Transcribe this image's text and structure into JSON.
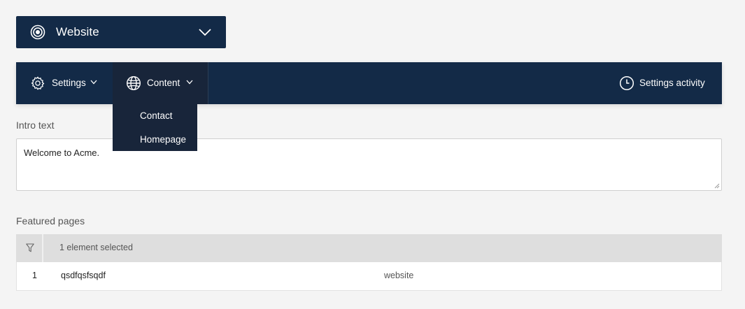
{
  "site_switcher": {
    "label": "Website",
    "icon": "target-icon"
  },
  "navbar": {
    "settings_label": "Settings",
    "content_label": "Content",
    "activity_label": "Settings activity"
  },
  "content_menu": {
    "items": [
      "Contact",
      "Homepage"
    ]
  },
  "intro": {
    "label": "Intro text",
    "value": "Welcome to Acme."
  },
  "featured": {
    "label": "Featured pages",
    "selected_text": "1 element selected",
    "rows": [
      {
        "index": "1",
        "title": "qsdfqsfsqdf",
        "site": "website"
      }
    ]
  },
  "colors": {
    "nav_bg": "#132a47",
    "dropdown_bg": "#18253a",
    "page_bg": "#f4f4f4"
  }
}
